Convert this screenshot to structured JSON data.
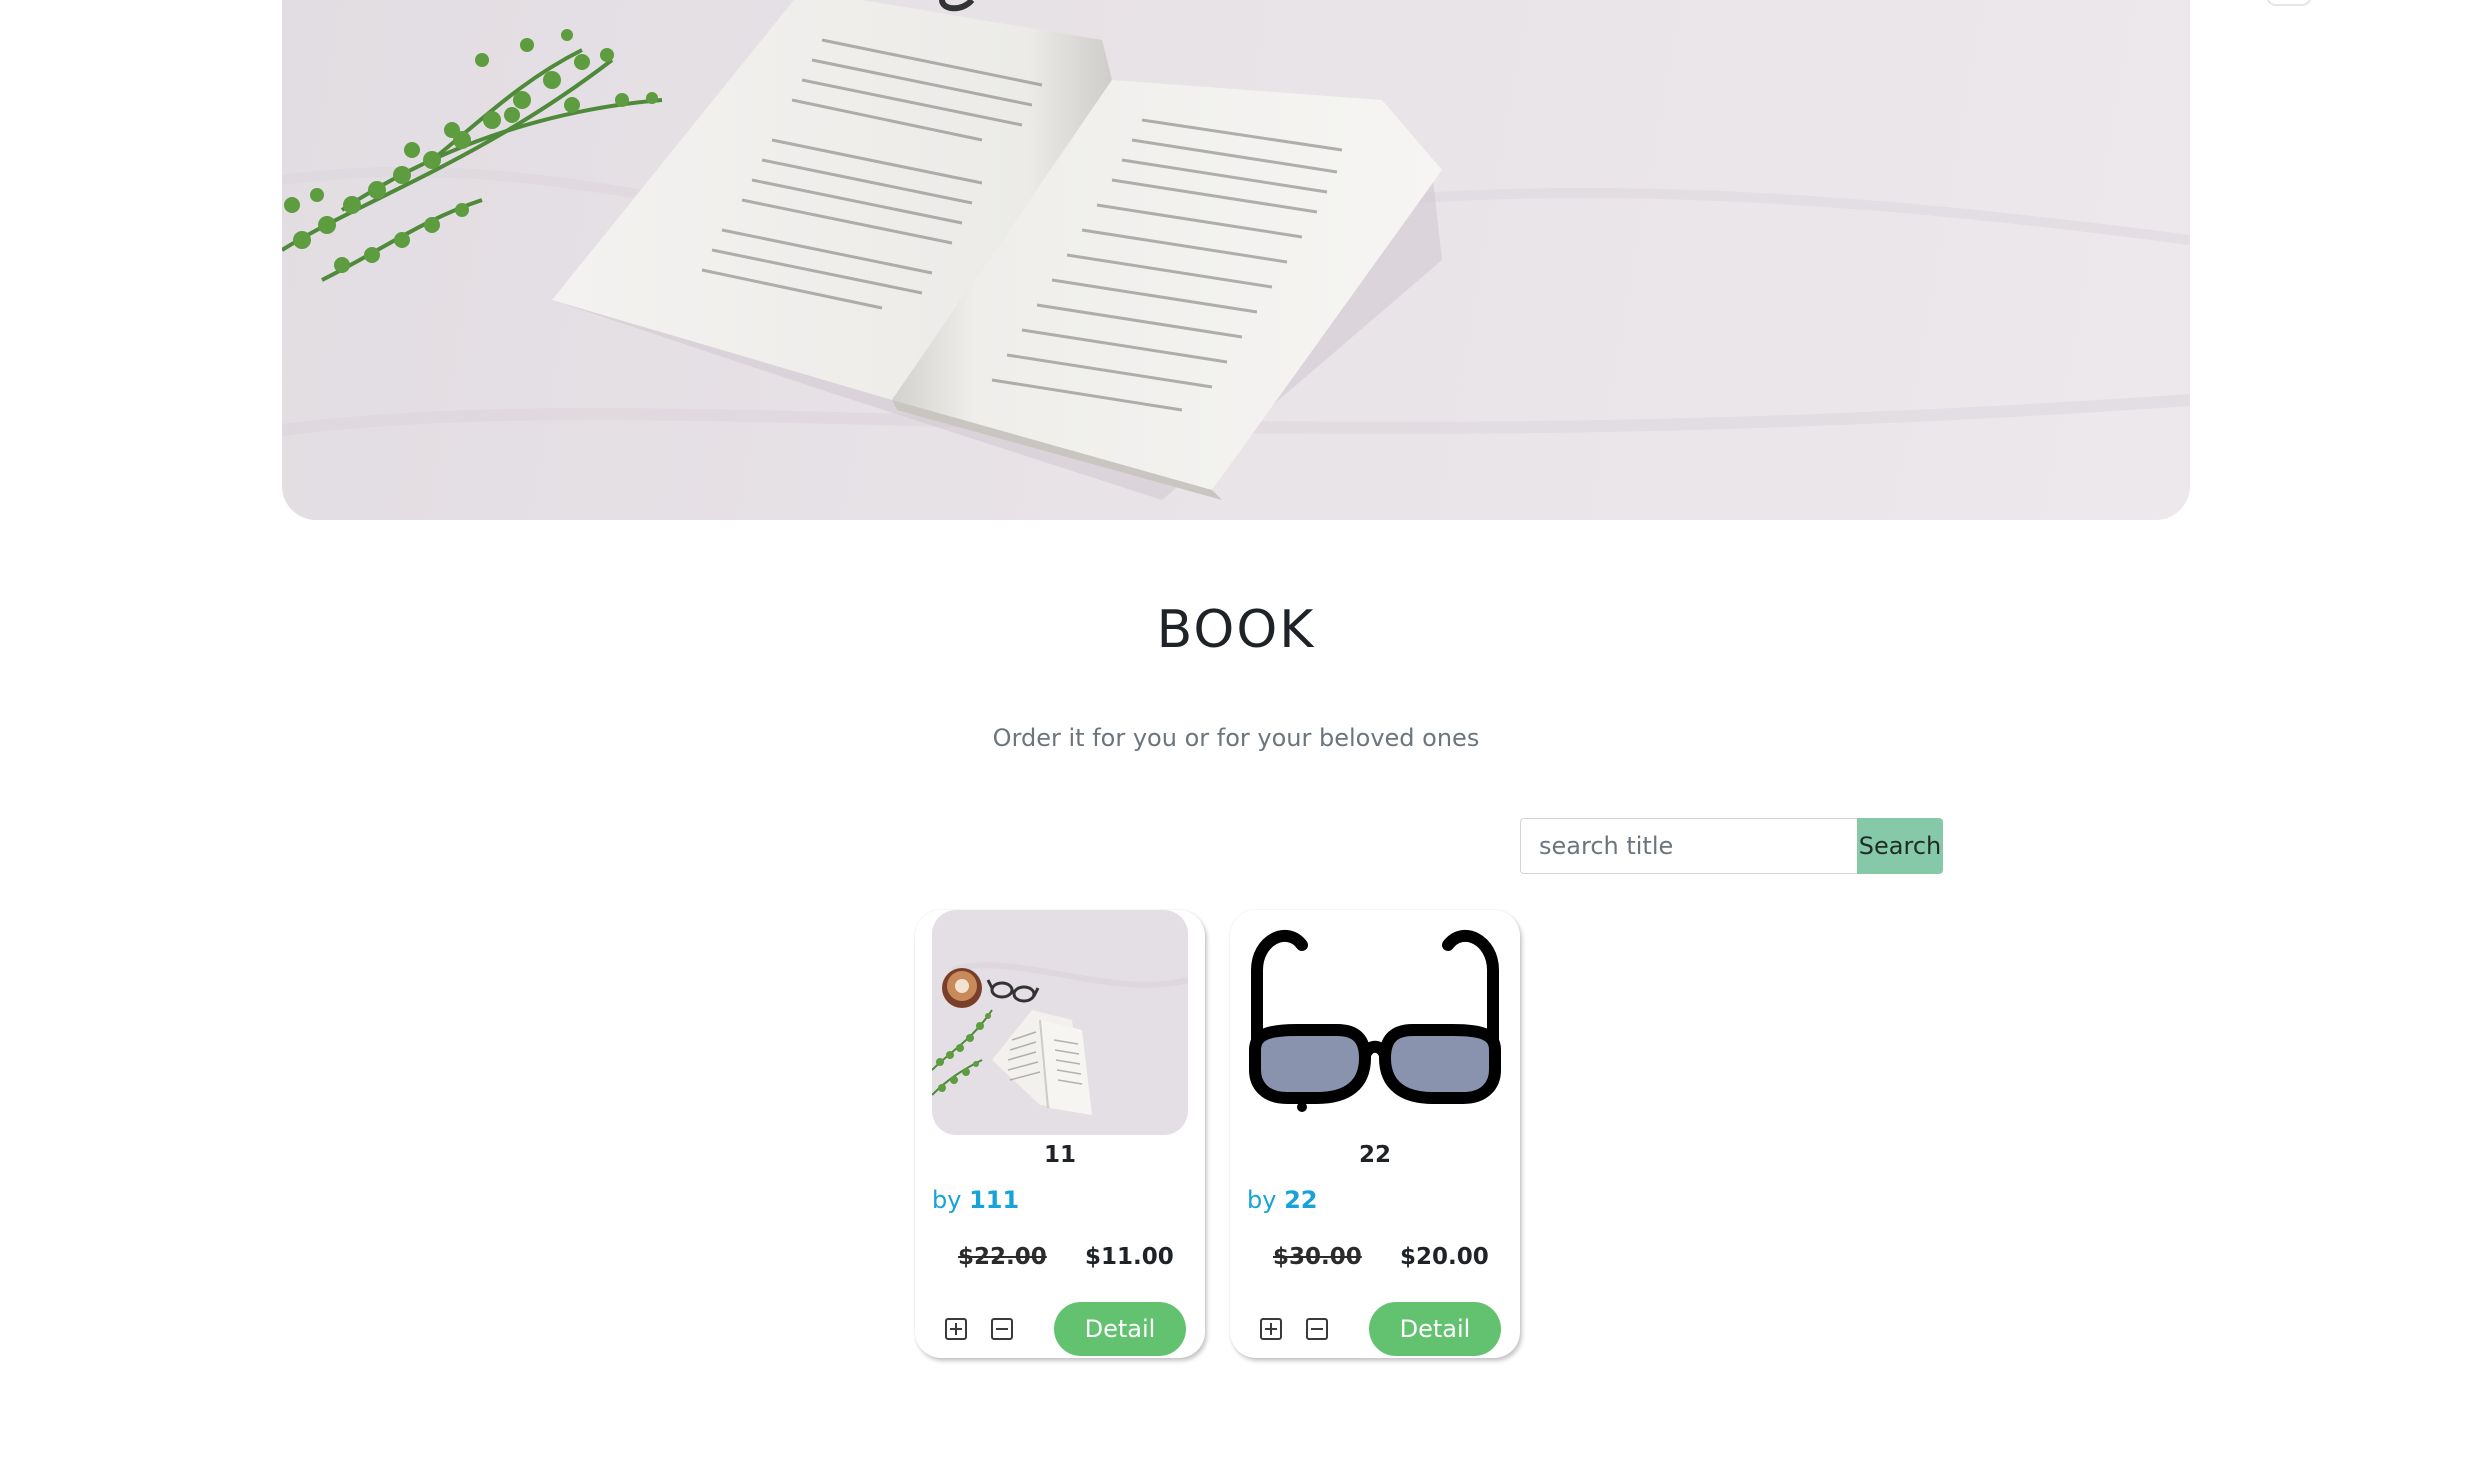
{
  "heading": {
    "title": "BOOK",
    "subtitle": "Order it for you or for your beloved ones"
  },
  "search": {
    "placeholder": "search title",
    "button_label": "Search",
    "button_color": "#85c9a8"
  },
  "products": [
    {
      "title": "11",
      "by_label": "by",
      "author": "111",
      "original_price": "$22.00",
      "sale_price": "$11.00",
      "detail_label": "Detail",
      "image": "book-on-table-photo"
    },
    {
      "title": "22",
      "by_label": "by",
      "author": "22",
      "original_price": "$30.00",
      "sale_price": "$20.00",
      "detail_label": "Detail",
      "image": "glasses-icon"
    }
  ],
  "colors": {
    "author": "#17a2d8",
    "detail_button": "#62c270"
  }
}
